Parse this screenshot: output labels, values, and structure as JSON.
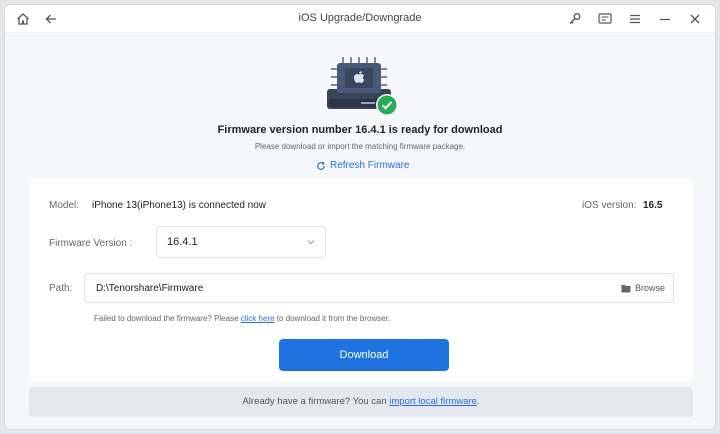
{
  "window": {
    "title": "iOS Upgrade/Downgrade"
  },
  "icons": {
    "home": "home-icon",
    "back": "back-arrow-icon",
    "key": "key-icon",
    "feedback": "feedback-icon",
    "menu": "menu-icon",
    "minimize": "minimize-icon",
    "close": "close-icon",
    "hero": "firmware-chip-icon",
    "check": "check-circle-icon",
    "refresh": "refresh-icon",
    "folder": "folder-icon",
    "chevron": "chevron-down-icon"
  },
  "hero": {
    "headline": "Firmware version number 16.4.1 is ready for download",
    "subline": "Please download or import the matching firmware package.",
    "refresh_label": "Refresh Firmware"
  },
  "device": {
    "model_label": "Model:",
    "model_value": "iPhone 13(iPhone13) is connected now",
    "ios_label": "iOS version:",
    "ios_value": "16.5"
  },
  "firmware": {
    "label": "Firmware Version :",
    "selected": "16.4.1"
  },
  "path": {
    "label": "Path:",
    "value": "D:\\Tenorshare\\Firmware",
    "browse_label": "Browse"
  },
  "fail_note": {
    "prefix": "Failed to download the firmware? Please ",
    "link": "click here",
    "suffix": " to download it from the browser."
  },
  "download_label": "Download",
  "bottom": {
    "prefix": "Already have a firmware? You can ",
    "link": "import local firmware",
    "suffix": "."
  },
  "colors": {
    "accent": "#1f73e0",
    "link": "#2b6fd6",
    "success": "#2aaa5a"
  }
}
